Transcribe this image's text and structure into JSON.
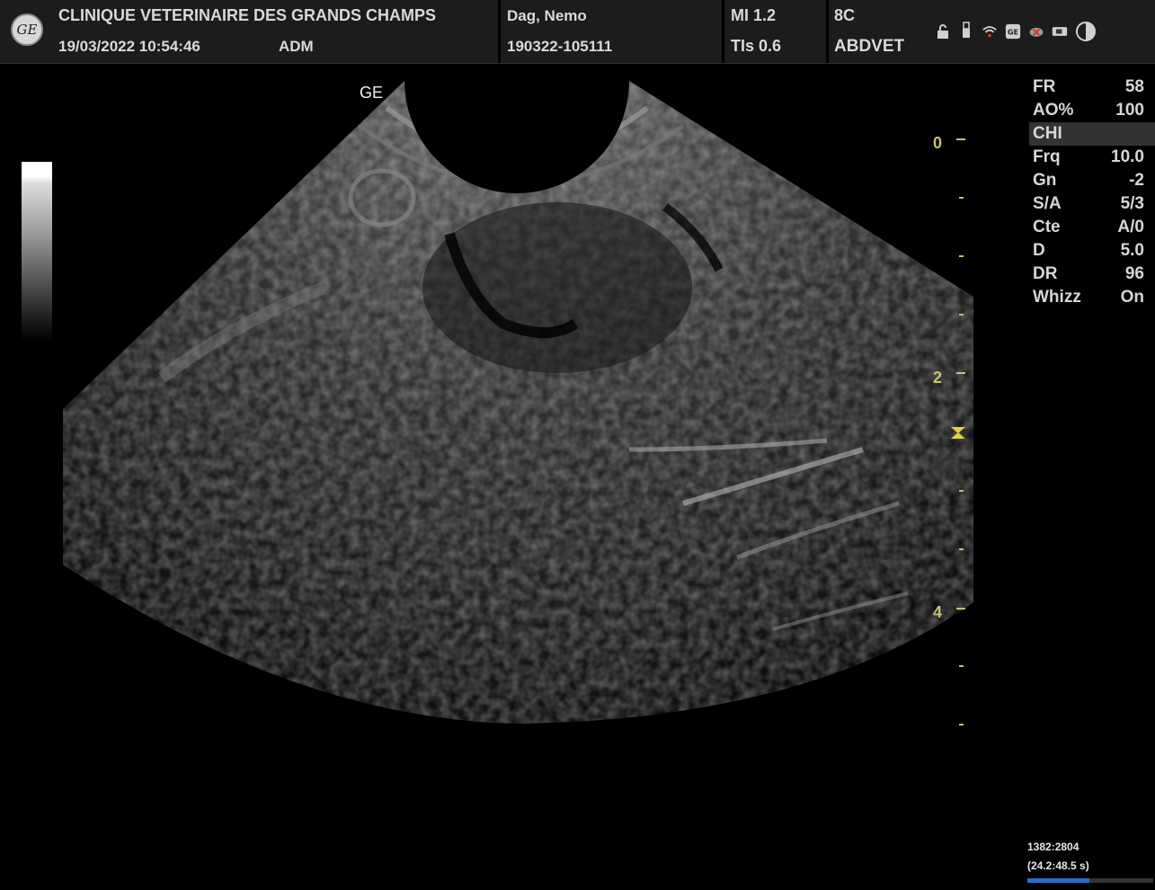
{
  "header": {
    "institution": "CLINIQUE VETERINAIRE DES GRANDS CHAMPS",
    "datetime": "19/03/2022 10:54:46",
    "operator": "ADM",
    "patient_name": "Dag, Nemo",
    "exam_id": "190322-105111",
    "mi": "MI 1.2",
    "tis": "TIs 0.6",
    "probe": "8C",
    "preset": "ABDVET",
    "logo_text": "GE"
  },
  "status_icons": [
    "lock-icon",
    "usb-icon",
    "wifi-icon",
    "ge-service-icon",
    "network-error-icon",
    "power-plug-icon",
    "brightness-icon"
  ],
  "image": {
    "orientation_marker": "GE"
  },
  "depth_scale": {
    "labels": [
      "0",
      "2",
      "4"
    ],
    "unit_hint": "cm",
    "focus_marker_color": "#e6d23a",
    "tick_color": "#c8c07a"
  },
  "params": [
    {
      "label": "FR",
      "value": "58"
    },
    {
      "label": "AO%",
      "value": "100"
    },
    {
      "label": "CHI",
      "value": "",
      "highlight": true
    },
    {
      "label": "Frq",
      "value": "10.0"
    },
    {
      "label": "Gn",
      "value": "-2"
    },
    {
      "label": "S/A",
      "value": "5/3"
    },
    {
      "label": "Cte",
      "value": "A/0"
    },
    {
      "label": "D",
      "value": "5.0"
    },
    {
      "label": "DR",
      "value": "96"
    },
    {
      "label": "Whizz",
      "value": "On"
    }
  ],
  "cine": {
    "frames": "1382:2804",
    "time": "(24.2:48.5 s)",
    "progress": 0.49
  }
}
